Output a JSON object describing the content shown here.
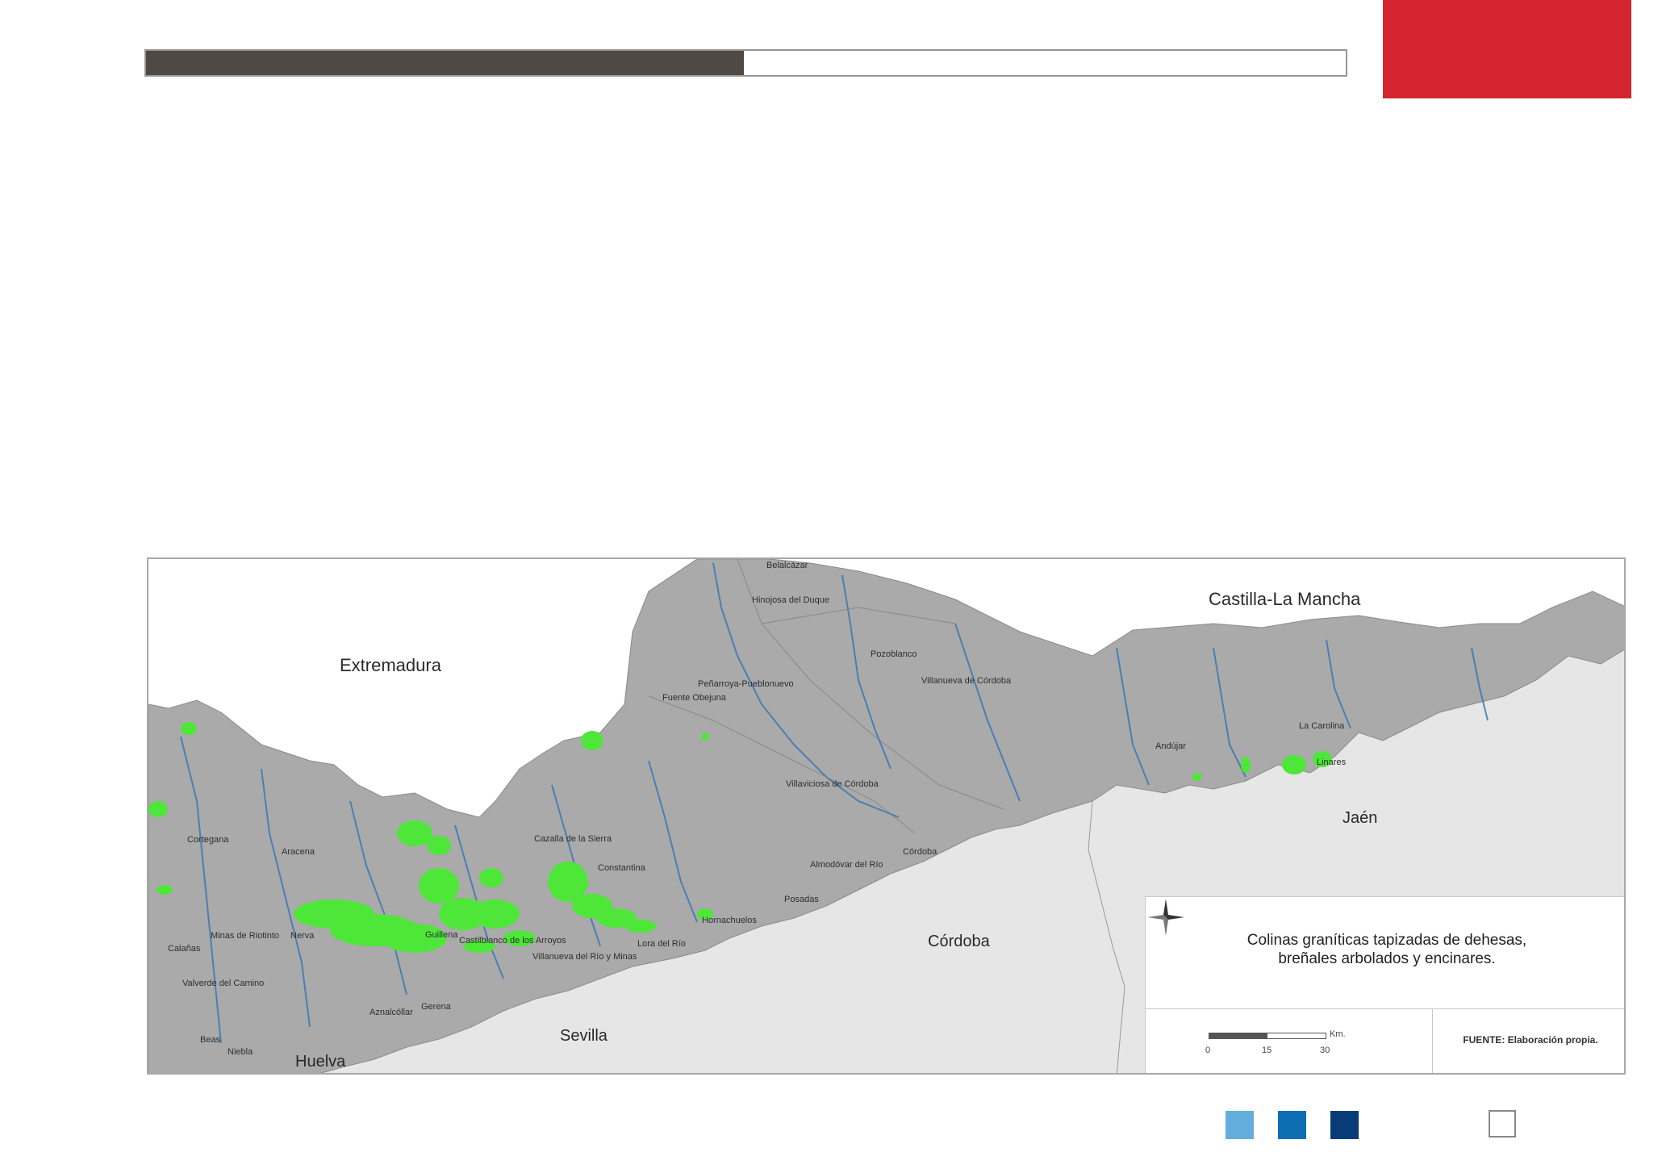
{
  "header": {
    "progress_fraction": 0.498,
    "progress_color": "#4f4946",
    "accent_color": "#d42530"
  },
  "map": {
    "regions": {
      "extremadura": "Extremadura",
      "castilla_la_mancha": "Castilla-La Mancha",
      "jaen": "Jaén",
      "cordoba": "Córdoba",
      "sevilla": "Sevilla",
      "huelva": "Huelva"
    },
    "towns": [
      "Belalcázar",
      "Hinojosa del Duque",
      "Pozoblanco",
      "Villanueva de Córdoba",
      "Peñarroya-Pueblonuevo",
      "Fuente Obejuna",
      "Villaviciosa de Córdoba",
      "Andújar",
      "La Carolina",
      "Linares",
      "Cortegana",
      "Aracena",
      "Cazalla de la Sierra",
      "Constantina",
      "Almodóvar del Río",
      "Córdoba",
      "Posadas",
      "Hornachuelos",
      "Minas de Riotinto",
      "Nerva",
      "Guillena",
      "Castilblanco de los Arroyos",
      "Lora del Río",
      "Villanueva del Río y Minas",
      "Calañas",
      "Valverde del Camino",
      "Aznalcóllar",
      "Gerena",
      "Beas",
      "Niebla"
    ],
    "colors": {
      "land": "#a9a9a9",
      "outside": "#e6e6e6",
      "rivers": "#3a78b5",
      "granite_hills": "#4fe63a"
    }
  },
  "legend": {
    "title": "Colinas graníticas tapizadas de dehesas,\nbreñales arbolados y encinares.",
    "scale_labels": [
      "0",
      "15",
      "30"
    ],
    "scale_unit": "Km.",
    "source": "FUENTE: Elaboración propia."
  },
  "footer": {
    "swatches": [
      "#64aedd",
      "#0f6db3",
      "#073c78"
    ]
  }
}
